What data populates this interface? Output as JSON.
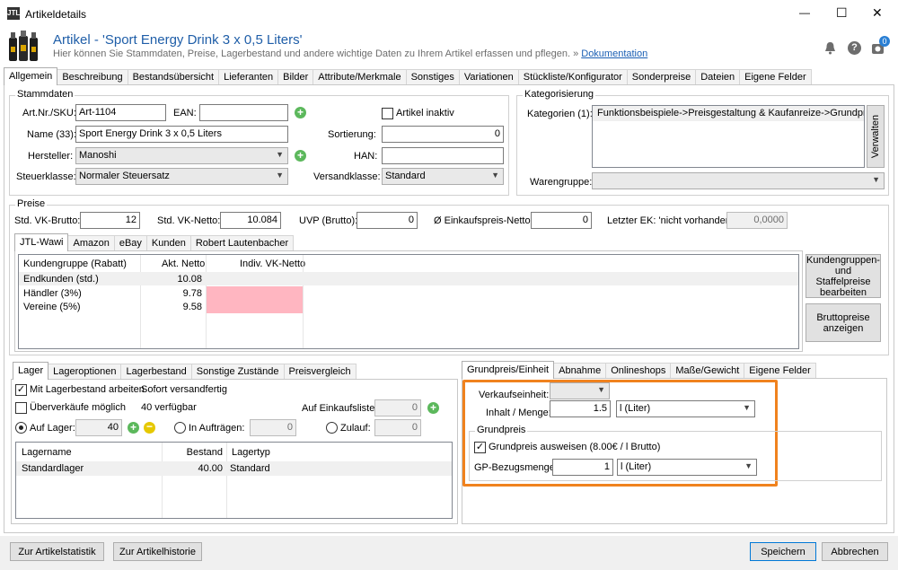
{
  "window": {
    "title": "Artikeldetails",
    "minimize": "—",
    "maximize": "☐",
    "close": "✕"
  },
  "header": {
    "title": "Artikel - 'Sport Energy Drink 3 x 0,5 Liters'",
    "subtitle": "Hier können Sie Stammdaten, Preise, Lagerbestand und andere wichtige Daten zu Ihrem Artikel erfassen und pflegen. »",
    "doc_link": "Dokumentation",
    "badge": "0"
  },
  "main_tabs": [
    "Allgemein",
    "Beschreibung",
    "Bestandsübersicht",
    "Lieferanten",
    "Bilder",
    "Attribute/Merkmale",
    "Sonstiges",
    "Variationen",
    "Stückliste/Konfigurator",
    "Sonderpreise",
    "Dateien",
    "Eigene Felder"
  ],
  "stamm": {
    "title": "Stammdaten",
    "sku_label": "Art.Nr./SKU:",
    "sku": "Art-1104",
    "ean_label": "EAN:",
    "ean": "",
    "inactive_label": "Artikel inaktiv",
    "name_label": "Name (33):",
    "name": "Sport Energy Drink 3 x 0,5 Liters",
    "sort_label": "Sortierung:",
    "sort": "0",
    "hersteller_label": "Hersteller:",
    "hersteller": "Manoshi",
    "han_label": "HAN:",
    "han": "",
    "steuer_label": "Steuerklasse:",
    "steuer": "Normaler Steuersatz",
    "versand_label": "Versandklasse:",
    "versand": "Standard"
  },
  "kat": {
    "title": "Kategorisierung",
    "kat_label": "Kategorien (1):",
    "kat_item": "Funktionsbeispiele->Preisgestaltung & Kaufanreize->Grundpreis",
    "verwalten": "Verwalten",
    "warengruppe_label": "Warengruppe:",
    "warengruppe": ""
  },
  "preise": {
    "title": "Preise",
    "vk_brutto_label": "Std. VK-Brutto:",
    "vk_brutto": "12",
    "vk_netto_label": "Std. VK-Netto:",
    "vk_netto": "10.084",
    "uvp_label": "UVP (Brutto):",
    "uvp": "0",
    "ek_label": "Ø Einkaufspreis-Netto:",
    "ek": "0",
    "letzter_label": "Letzter EK: 'nicht vorhanden'",
    "letzter": "0,0000",
    "tabs": [
      "JTL-Wawi",
      "Amazon",
      "eBay",
      "Kunden",
      "Robert Lautenbacher"
    ],
    "cols": [
      "Kundengruppe (Rabatt)",
      "Akt. Netto",
      "Indiv. VK-Netto"
    ],
    "rows": [
      {
        "g": "Endkunden (std.)",
        "n": "10.08"
      },
      {
        "g": "Händler (3%)",
        "n": "9.78"
      },
      {
        "g": "Vereine (5%)",
        "n": "9.58"
      }
    ],
    "btn_staffel": "Kundengruppen- und Staffelpreise bearbeiten",
    "btn_brutto": "Bruttopreise anzeigen"
  },
  "lager": {
    "tabs": [
      "Lager",
      "Lageroptionen",
      "Lagerbestand",
      "Sonstige Zustände",
      "Preisvergleich"
    ],
    "mit_label": "Mit Lagerbestand arbeiten",
    "mit_value": "Sofort versandfertig",
    "ueber_label": "Überverkäufe möglich",
    "ueber_value": "40  verfügbar",
    "einkauf_label": "Auf Einkaufsliste:",
    "einkauf": "0",
    "auflager_label": "Auf Lager:",
    "auflager": "40",
    "auftrag_label": "In Aufträgen:",
    "auftrag": "0",
    "zulauf_label": "Zulauf:",
    "zulauf": "0",
    "cols": [
      "Lagername",
      "Bestand",
      "Lagertyp"
    ],
    "rows": [
      {
        "n": "Standardlager",
        "b": "40.00",
        "t": "Standard"
      }
    ]
  },
  "grundpreis": {
    "tabs": [
      "Grundpreis/Einheit",
      "Abnahme",
      "Onlineshops",
      "Maße/Gewicht",
      "Eigene Felder"
    ],
    "vk_einheit_label": "Verkaufseinheit:",
    "vk_einheit": "",
    "inhalt_label": "Inhalt / Menge:",
    "inhalt": "1.5",
    "inhalt_unit": "l (Liter)",
    "gp_title": "Grundpreis",
    "gp_show_label": "Grundpreis ausweisen (8.00€ / l Brutto)",
    "bezug_label": "GP-Bezugsmenge:",
    "bezug": "1",
    "bezug_unit": "l (Liter)",
    "highlight_color": "#f0821e"
  },
  "footer": {
    "stat": "Zur Artikelstatistik",
    "hist": "Zur Artikelhistorie",
    "save": "Speichern",
    "cancel": "Abbrechen"
  }
}
